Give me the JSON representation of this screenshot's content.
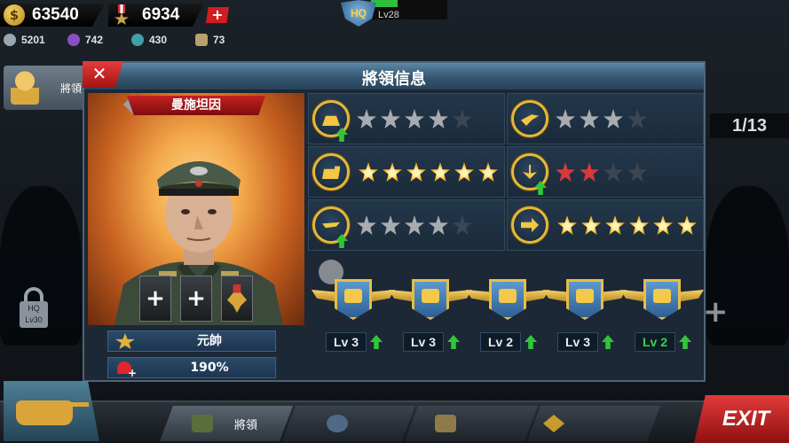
{
  "resources": {
    "gold": "63540",
    "medals": "6934",
    "add_label": "+",
    "gear": "5201",
    "oil": "742",
    "parts": "430",
    "cards": "73"
  },
  "hq": {
    "badge": "HQ",
    "level": "Lv28",
    "progress": 0.35
  },
  "sidebar": {
    "tab_label": "將領",
    "lock_hq": "HQ",
    "lock_level": "Lv30"
  },
  "counter": "1/13",
  "dialog": {
    "title": "將領信息",
    "close_label": "✕",
    "general_name": "曼施坦因",
    "slots": [
      "+",
      "+"
    ],
    "rank": "元帥",
    "health": "190%"
  },
  "skills": [
    {
      "icon": "infantry-helmet-icon",
      "stars_total": 5,
      "stars_filled": 4,
      "style": "gray",
      "upgradable": true
    },
    {
      "icon": "artillery-icon",
      "stars_total": 4,
      "stars_filled": 3,
      "style": "gray",
      "upgradable": false
    },
    {
      "icon": "tank-icon",
      "stars_total": 6,
      "stars_filled": 6,
      "style": "gold",
      "upgradable": false
    },
    {
      "icon": "navy-anchor-icon",
      "stars_total": 4,
      "stars_filled": 2,
      "style": "red",
      "upgradable": true
    },
    {
      "icon": "aircraft-icon",
      "stars_total": 5,
      "stars_filled": 4,
      "style": "gray",
      "upgradable": true
    },
    {
      "icon": "movement-icon",
      "stars_total": 6,
      "stars_filled": 6,
      "style": "gold",
      "upgradable": false
    }
  ],
  "medals": [
    {
      "level": "Lv 3",
      "highlight": false
    },
    {
      "level": "Lv 3",
      "highlight": false
    },
    {
      "level": "Lv 2",
      "highlight": false
    },
    {
      "level": "Lv 3",
      "highlight": false
    },
    {
      "level": "Lv 2",
      "highlight": true
    }
  ],
  "bottom_nav": {
    "generals_label": "將領",
    "exit_label": "EXIT"
  },
  "colors": {
    "accent_gold": "#e4b83a",
    "close_red": "#d01e1e",
    "upgrade_green": "#2fc638"
  }
}
